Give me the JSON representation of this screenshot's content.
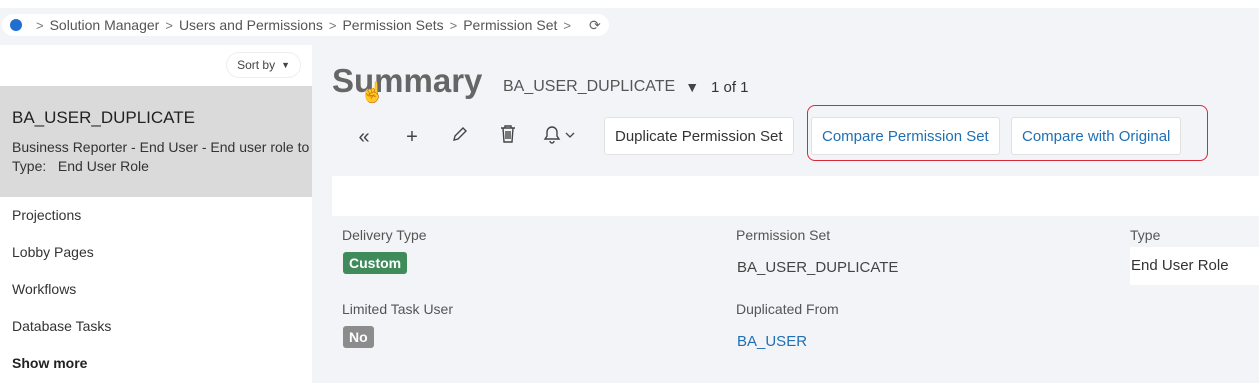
{
  "breadcrumb": {
    "items": [
      "Solution Manager",
      "Users and Permissions",
      "Permission Sets",
      "Permission Set"
    ],
    "separator": ">",
    "refresh_icon": "⟳"
  },
  "left_panel": {
    "sort_label": "Sort by",
    "selected": {
      "title": "BA_USER_DUPLICATE",
      "description": "Business Reporter - End User - End user role to",
      "type_line": "Type:   End User Role"
    },
    "nav_items": [
      "Projections",
      "Lobby Pages",
      "Workflows",
      "Database Tasks"
    ],
    "show_more": "Show more"
  },
  "header": {
    "title": "Summary",
    "record": "BA_USER_DUPLICATE",
    "pager": "1 of 1"
  },
  "toolbar": {
    "duplicate_label": "Duplicate Permission Set",
    "compare_label": "Compare Permission Set",
    "compare_original_label": "Compare with Original",
    "highlight_color": "#d9283a"
  },
  "details": {
    "delivery_type_label": "Delivery Type",
    "delivery_type_value": "Custom",
    "permission_set_label": "Permission Set",
    "permission_set_value": "BA_USER_DUPLICATE",
    "type_label": "Type",
    "type_value": "End User Role",
    "limited_task_label": "Limited Task User",
    "limited_task_value": "No",
    "duplicated_from_label": "Duplicated From",
    "duplicated_from_value": "BA_USER"
  },
  "colors": {
    "accent": "#1f6fb4",
    "custom_badge": "#3f8b5a",
    "no_badge": "#8c8c8c"
  }
}
